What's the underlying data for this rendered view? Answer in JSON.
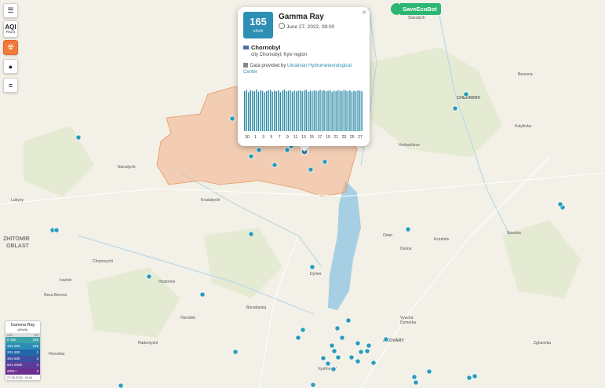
{
  "controls": {
    "menu_icon": "hamburger-icon",
    "aqi_label": "AQI",
    "aqi_sub": "PM2.5",
    "radiation_icon": "radiation-icon",
    "fire_icon": "fire-icon",
    "layers_icon": "layers-icon"
  },
  "brand": {
    "name": "SaveEcoBot"
  },
  "map_labels": {
    "zhitomir_oblast": [
      "ZHITOMIR",
      "OBLAST"
    ],
    "chernihiv": "CHERNIHIV",
    "brovary": "BROVARY",
    "places": [
      "Narodychi",
      "Kraslatychi",
      "Lubyny",
      "Chopovychi",
      "Ivankiv",
      "Hostomel",
      "Dymer",
      "Oster",
      "Kozelets",
      "Nosivka",
      "Desna",
      "Borodianka",
      "Radomyshl",
      "Horodok",
      "Slavutych",
      "Chernihiv",
      "Kulykivka",
      "Berezna",
      "Nova Borova",
      "Vyshhorod",
      "Zghurivka",
      "Vyacha",
      "Dymerka",
      "Horbachevo",
      "Horodnia"
    ]
  },
  "popup": {
    "value": "165",
    "unit": "nSv/h",
    "title": "Gamma Ray",
    "date": "June 27, 2022, 09:00",
    "location": "Chornobyl",
    "sublocation": "city Chornobyl, Kyiv region",
    "source_prefix": "Data provided by ",
    "source_link": "Ukrainian Hydrometeorological Center",
    "close": "×"
  },
  "chart_data": {
    "type": "bar",
    "color": "#2a8aa5",
    "x_tick_labels": [
      "30",
      "1",
      "3",
      "5",
      "7",
      "9",
      "11",
      "13",
      "15",
      "17",
      "19",
      "21",
      "23",
      "25",
      "27"
    ],
    "values": [
      0.82,
      0.85,
      0.8,
      0.84,
      0.83,
      0.82,
      0.86,
      0.81,
      0.84,
      0.83,
      0.8,
      0.82,
      0.84,
      0.85,
      0.81,
      0.83,
      0.82,
      0.84,
      0.8,
      0.83,
      0.86,
      0.82,
      0.83,
      0.84,
      0.81,
      0.83,
      0.82,
      0.83,
      0.84,
      0.82,
      0.84,
      0.85,
      0.81,
      0.83,
      0.82,
      0.84,
      0.83,
      0.82,
      0.85,
      0.83,
      0.84,
      0.82,
      0.83,
      0.84,
      0.81,
      0.83,
      0.82,
      0.84,
      0.83,
      0.82,
      0.85,
      0.83,
      0.82,
      0.84,
      0.81,
      0.83,
      0.82,
      0.84,
      0.83,
      0.82
    ]
  },
  "legend": {
    "title": "Gamma Ray",
    "unit": "(nSv/h)",
    "head_left": "nSv",
    "head_right": "ZR",
    "rows": [
      {
        "range": "0-150",
        "count": "166",
        "color": "#3aa3a8"
      },
      {
        "range": "151-200",
        "count": "216",
        "color": "#2b8cb4"
      },
      {
        "range": "201-300",
        "count": "1",
        "color": "#2266a8"
      },
      {
        "range": "301-500",
        "count": "3",
        "color": "#3d4fa0"
      },
      {
        "range": "501-2000",
        "count": "4",
        "color": "#5b3c9a"
      },
      {
        "range": "2001+",
        "count": "3",
        "color": "#6a2f8f"
      }
    ],
    "timestamp": "27.06.2022, 18:44"
  },
  "markers_color": "#2b9dbb"
}
